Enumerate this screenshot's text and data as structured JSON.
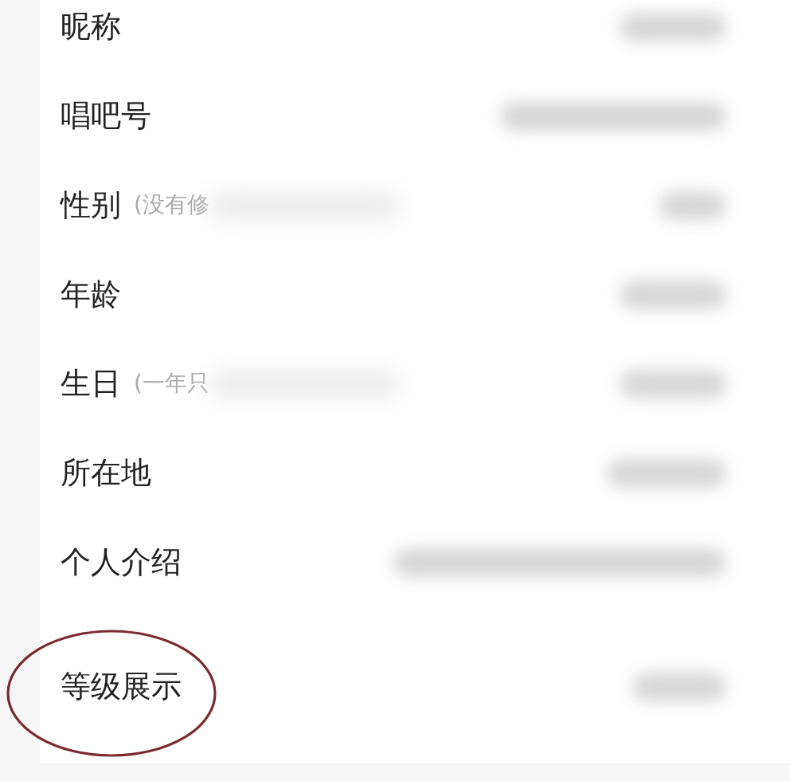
{
  "rows": [
    {
      "label": "昵称",
      "circled": false
    },
    {
      "label": "唱吧号",
      "circled": false
    },
    {
      "label": "性别",
      "hint": "(没有修",
      "circled": false
    },
    {
      "label": "年龄",
      "circled": false
    },
    {
      "label": "生日",
      "hint": "(一年只",
      "circled": false
    },
    {
      "label": "所在地",
      "circled": false
    },
    {
      "label": "个人介绍",
      "circled": false
    },
    {
      "label": "等级展示",
      "circled": true
    }
  ]
}
